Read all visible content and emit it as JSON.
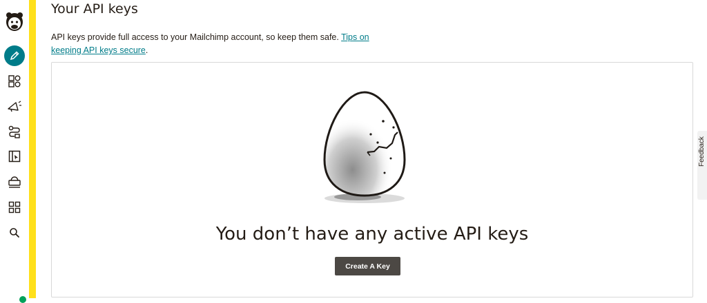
{
  "nav": {
    "items": [
      {
        "name": "create",
        "icon": "pencil-icon",
        "active": true
      },
      {
        "name": "audience",
        "icon": "audience-icon",
        "active": false
      },
      {
        "name": "campaigns",
        "icon": "megaphone-icon",
        "active": false
      },
      {
        "name": "automations",
        "icon": "automation-icon",
        "active": false
      },
      {
        "name": "website",
        "icon": "website-icon",
        "active": false
      },
      {
        "name": "content",
        "icon": "content-icon",
        "active": false
      },
      {
        "name": "integrations",
        "icon": "grid-icon",
        "active": false
      },
      {
        "name": "search",
        "icon": "search-icon",
        "active": false
      }
    ]
  },
  "page": {
    "title": "Your API keys",
    "intro_text": "API keys provide full access to your Mailchimp account, so keep them safe.",
    "intro_link": "Tips on keeping API keys secure",
    "intro_end": "."
  },
  "empty_state": {
    "title": "You don’t have any active API keys",
    "button_label": "Create A Key",
    "illustration": "cracked-egg-illustration"
  },
  "feedback": {
    "label": "Feedback"
  },
  "colors": {
    "accent": "#007c89",
    "brand_yellow": "#ffe01b",
    "button": "#4c4844",
    "text": "#241c15"
  }
}
